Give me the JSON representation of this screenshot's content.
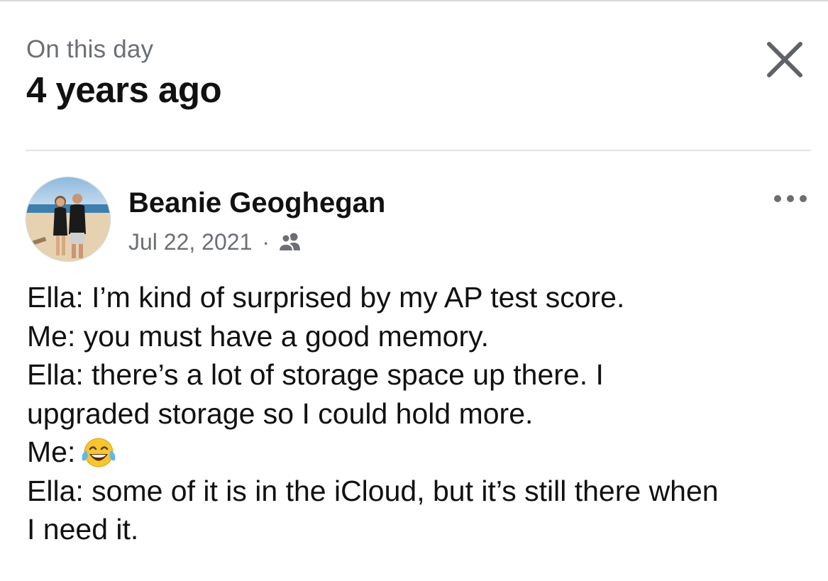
{
  "header": {
    "eyebrow": "On this day",
    "title": "4 years ago",
    "close_icon": "close-icon"
  },
  "post": {
    "author": "Beanie Geoghegan",
    "date": "Jul 22, 2021",
    "separator": "·",
    "audience_icon": "friends-icon",
    "more_icon": "more-options-icon",
    "lines": [
      "Ella: I’m kind of surprised by my AP test score.",
      "Me: you must have a good memory.",
      "Ella: there’s a lot of storage space up there. I",
      "upgraded storage so I could hold more.",
      "Me:",
      "Ella: some of it is in the iCloud, but it’s still there when",
      "I need it."
    ],
    "emoji": "face-with-tears-of-joy"
  },
  "colors": {
    "primary_text": "#111111",
    "secondary_text": "#6b6f74",
    "divider": "#e3e3e3",
    "background": "#ffffff"
  }
}
